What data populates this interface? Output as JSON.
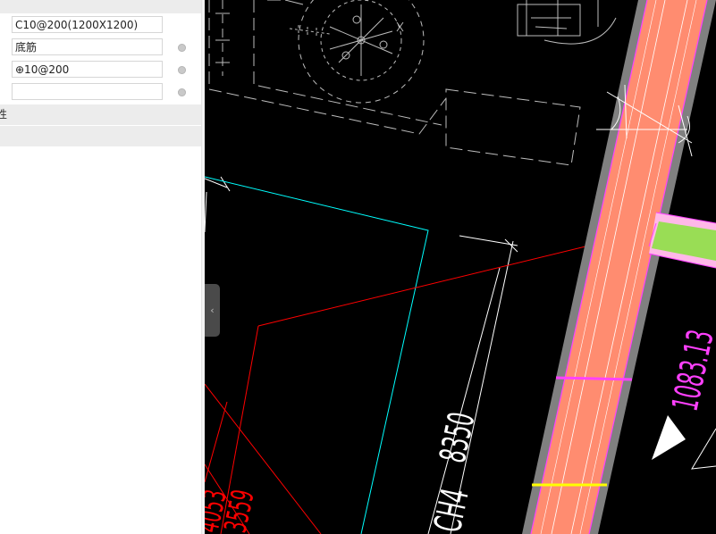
{
  "properties_panel": {
    "rows": [
      {
        "value": "C10@200(1200X1200)"
      },
      {
        "value": "底筋"
      },
      {
        "value": "⊕10@200"
      },
      {
        "value": ""
      }
    ],
    "section_label": "性",
    "section2_label": ""
  },
  "panel_toggle": {
    "glyph": "‹"
  },
  "drawing": {
    "dim_vertical": "8350",
    "label_ch": "CH4",
    "dim_magenta": "1083.13",
    "dim_left_a": "4053",
    "dim_left_b": "3559"
  },
  "colors": {
    "cad_background": "#000000",
    "wall_fill": "#ff8c70",
    "wall_border": "#808080",
    "accent_magenta": "#ff40ff",
    "cyan": "#00ffff",
    "red": "#ff0000",
    "green": "#99dd55",
    "yellow": "#ffff00"
  }
}
